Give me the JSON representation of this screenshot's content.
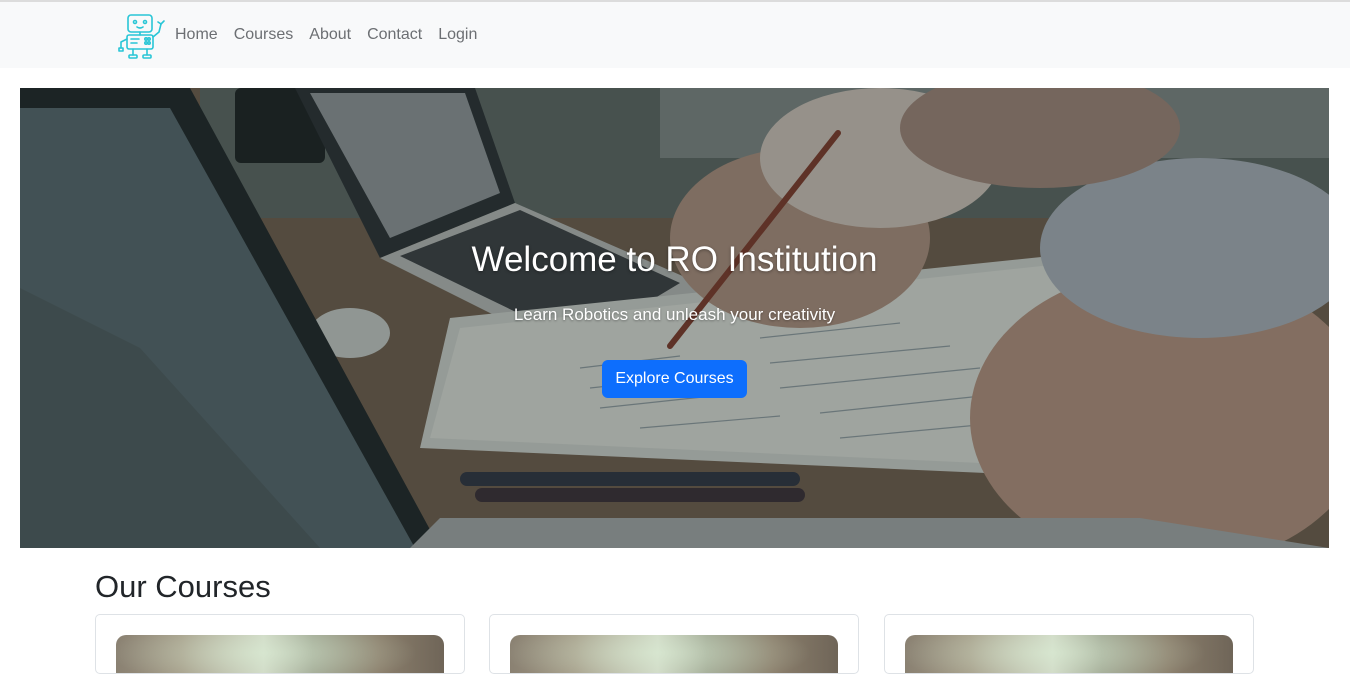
{
  "navbar": {
    "logo_icon": "robot-logo-icon",
    "links": [
      {
        "label": "Home"
      },
      {
        "label": "Courses"
      },
      {
        "label": "About"
      },
      {
        "label": "Contact"
      },
      {
        "label": "Login"
      }
    ]
  },
  "hero": {
    "title": "Welcome to RO Institution",
    "subtitle": "Learn Robotics and unleash your creativity",
    "button_label": "Explore Courses"
  },
  "courses": {
    "title": "Our Courses"
  },
  "colors": {
    "primary": "#0d6efd",
    "navbar_bg": "#f8f9fa",
    "logo": "#29c6d6"
  }
}
